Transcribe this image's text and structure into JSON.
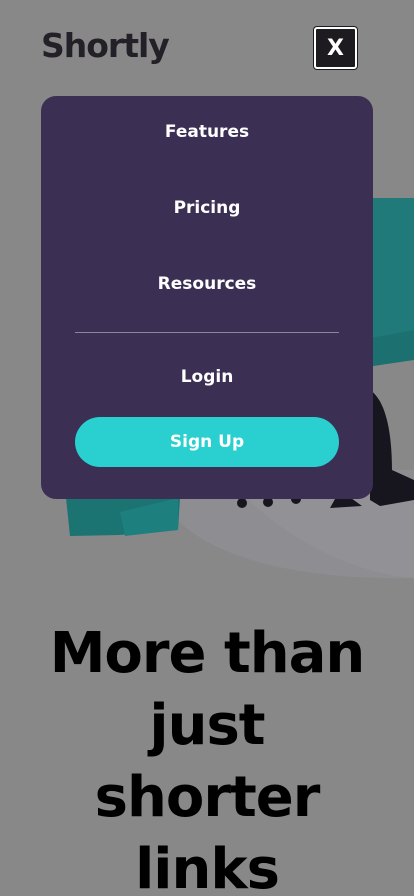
{
  "header": {
    "logo": "Shortly",
    "close_label": "X"
  },
  "menu": {
    "items": [
      {
        "label": "Features"
      },
      {
        "label": "Pricing"
      },
      {
        "label": "Resources"
      }
    ],
    "login_label": "Login",
    "signup_label": "Sign Up"
  },
  "hero": {
    "title_lines": [
      "More than",
      "just",
      "shorter",
      "links"
    ]
  },
  "colors": {
    "overlay_background": "#888888",
    "menu_background": "#3b3054",
    "accent_cyan": "#2acfcf",
    "logo_text": "#232127"
  },
  "icons": {
    "close": "close-icon",
    "illustration": "working-illustration"
  }
}
